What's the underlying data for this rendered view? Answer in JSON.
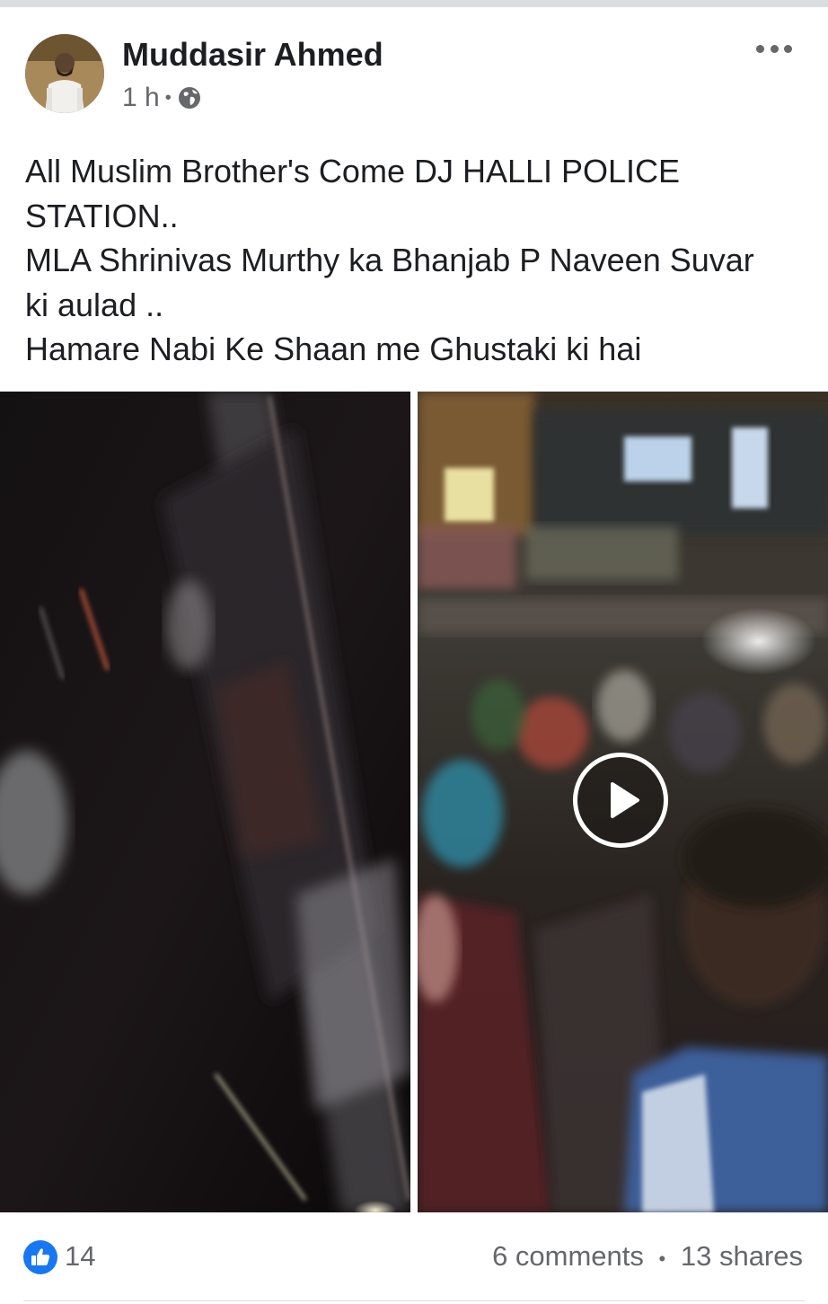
{
  "post": {
    "author": "Muddasir Ahmed",
    "timestamp": "1 h",
    "meta_separator": "•",
    "audience_icon": "globe-icon",
    "text_lines": [
      "All Muslim Brother's Come DJ HALLI POLICE",
      "STATION..",
      "MLA Shrinivas Murthy ka Bhanjab P Naveen Suvar",
      "ki aulad ..",
      "Hamare Nabi Ke Shaan me Ghustaki ki hai"
    ]
  },
  "footer": {
    "reaction_icon": "like-icon",
    "reaction_count": "14",
    "comments": "6 comments",
    "separator": "•",
    "shares": "13 shares"
  },
  "colors": {
    "facebook_blue": "#1877f2",
    "meta_gray": "#65676b",
    "text": "#1c1e21"
  }
}
